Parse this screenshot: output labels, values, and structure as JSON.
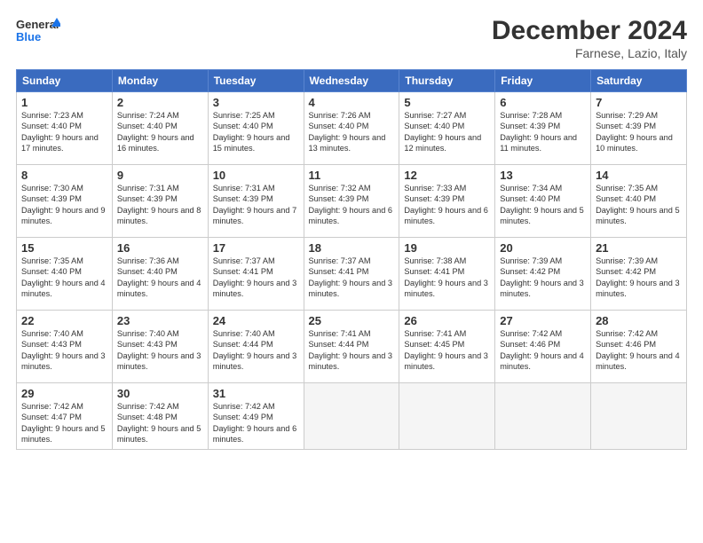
{
  "header": {
    "logo_line1": "General",
    "logo_line2": "Blue",
    "month": "December 2024",
    "location": "Farnese, Lazio, Italy"
  },
  "columns": [
    "Sunday",
    "Monday",
    "Tuesday",
    "Wednesday",
    "Thursday",
    "Friday",
    "Saturday"
  ],
  "weeks": [
    [
      {
        "day": "1",
        "info": "Sunrise: 7:23 AM\nSunset: 4:40 PM\nDaylight: 9 hours and 17 minutes."
      },
      {
        "day": "2",
        "info": "Sunrise: 7:24 AM\nSunset: 4:40 PM\nDaylight: 9 hours and 16 minutes."
      },
      {
        "day": "3",
        "info": "Sunrise: 7:25 AM\nSunset: 4:40 PM\nDaylight: 9 hours and 15 minutes."
      },
      {
        "day": "4",
        "info": "Sunrise: 7:26 AM\nSunset: 4:40 PM\nDaylight: 9 hours and 13 minutes."
      },
      {
        "day": "5",
        "info": "Sunrise: 7:27 AM\nSunset: 4:40 PM\nDaylight: 9 hours and 12 minutes."
      },
      {
        "day": "6",
        "info": "Sunrise: 7:28 AM\nSunset: 4:39 PM\nDaylight: 9 hours and 11 minutes."
      },
      {
        "day": "7",
        "info": "Sunrise: 7:29 AM\nSunset: 4:39 PM\nDaylight: 9 hours and 10 minutes."
      }
    ],
    [
      {
        "day": "8",
        "info": "Sunrise: 7:30 AM\nSunset: 4:39 PM\nDaylight: 9 hours and 9 minutes."
      },
      {
        "day": "9",
        "info": "Sunrise: 7:31 AM\nSunset: 4:39 PM\nDaylight: 9 hours and 8 minutes."
      },
      {
        "day": "10",
        "info": "Sunrise: 7:31 AM\nSunset: 4:39 PM\nDaylight: 9 hours and 7 minutes."
      },
      {
        "day": "11",
        "info": "Sunrise: 7:32 AM\nSunset: 4:39 PM\nDaylight: 9 hours and 6 minutes."
      },
      {
        "day": "12",
        "info": "Sunrise: 7:33 AM\nSunset: 4:39 PM\nDaylight: 9 hours and 6 minutes."
      },
      {
        "day": "13",
        "info": "Sunrise: 7:34 AM\nSunset: 4:40 PM\nDaylight: 9 hours and 5 minutes."
      },
      {
        "day": "14",
        "info": "Sunrise: 7:35 AM\nSunset: 4:40 PM\nDaylight: 9 hours and 5 minutes."
      }
    ],
    [
      {
        "day": "15",
        "info": "Sunrise: 7:35 AM\nSunset: 4:40 PM\nDaylight: 9 hours and 4 minutes."
      },
      {
        "day": "16",
        "info": "Sunrise: 7:36 AM\nSunset: 4:40 PM\nDaylight: 9 hours and 4 minutes."
      },
      {
        "day": "17",
        "info": "Sunrise: 7:37 AM\nSunset: 4:41 PM\nDaylight: 9 hours and 3 minutes."
      },
      {
        "day": "18",
        "info": "Sunrise: 7:37 AM\nSunset: 4:41 PM\nDaylight: 9 hours and 3 minutes."
      },
      {
        "day": "19",
        "info": "Sunrise: 7:38 AM\nSunset: 4:41 PM\nDaylight: 9 hours and 3 minutes."
      },
      {
        "day": "20",
        "info": "Sunrise: 7:39 AM\nSunset: 4:42 PM\nDaylight: 9 hours and 3 minutes."
      },
      {
        "day": "21",
        "info": "Sunrise: 7:39 AM\nSunset: 4:42 PM\nDaylight: 9 hours and 3 minutes."
      }
    ],
    [
      {
        "day": "22",
        "info": "Sunrise: 7:40 AM\nSunset: 4:43 PM\nDaylight: 9 hours and 3 minutes."
      },
      {
        "day": "23",
        "info": "Sunrise: 7:40 AM\nSunset: 4:43 PM\nDaylight: 9 hours and 3 minutes."
      },
      {
        "day": "24",
        "info": "Sunrise: 7:40 AM\nSunset: 4:44 PM\nDaylight: 9 hours and 3 minutes."
      },
      {
        "day": "25",
        "info": "Sunrise: 7:41 AM\nSunset: 4:44 PM\nDaylight: 9 hours and 3 minutes."
      },
      {
        "day": "26",
        "info": "Sunrise: 7:41 AM\nSunset: 4:45 PM\nDaylight: 9 hours and 3 minutes."
      },
      {
        "day": "27",
        "info": "Sunrise: 7:42 AM\nSunset: 4:46 PM\nDaylight: 9 hours and 4 minutes."
      },
      {
        "day": "28",
        "info": "Sunrise: 7:42 AM\nSunset: 4:46 PM\nDaylight: 9 hours and 4 minutes."
      }
    ],
    [
      {
        "day": "29",
        "info": "Sunrise: 7:42 AM\nSunset: 4:47 PM\nDaylight: 9 hours and 5 minutes."
      },
      {
        "day": "30",
        "info": "Sunrise: 7:42 AM\nSunset: 4:48 PM\nDaylight: 9 hours and 5 minutes."
      },
      {
        "day": "31",
        "info": "Sunrise: 7:42 AM\nSunset: 4:49 PM\nDaylight: 9 hours and 6 minutes."
      },
      {
        "day": "",
        "info": ""
      },
      {
        "day": "",
        "info": ""
      },
      {
        "day": "",
        "info": ""
      },
      {
        "day": "",
        "info": ""
      }
    ]
  ]
}
